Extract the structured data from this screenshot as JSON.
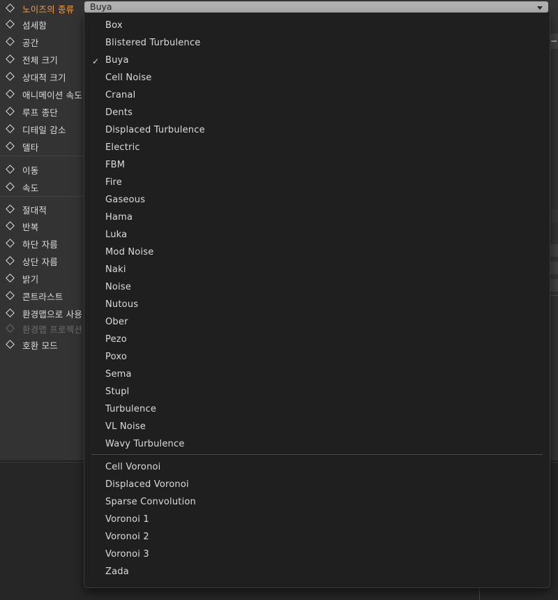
{
  "panel": {
    "properties": [
      {
        "label": "노이즈의 종류",
        "active": true
      },
      {
        "label": "섬세함"
      },
      {
        "label": "공간"
      },
      {
        "label": "전체 크기"
      },
      {
        "label": "상대적 크기"
      },
      {
        "label": "애니메이션 속도"
      },
      {
        "label": "루프 종단"
      },
      {
        "label": "디테일 감소"
      },
      {
        "label": "델타"
      },
      {
        "label": "이동"
      },
      {
        "label": "속도"
      },
      {
        "label": "절대적"
      },
      {
        "label": "반복"
      },
      {
        "label": "하단 자름"
      },
      {
        "label": "상단 자름"
      },
      {
        "label": "밝기"
      },
      {
        "label": "콘트라스트"
      },
      {
        "label": "환경맵으로 사용"
      },
      {
        "label": "환경맵 프로젝션",
        "disabled": true
      },
      {
        "label": "호환 모드"
      }
    ]
  },
  "select": {
    "value": "Buya"
  },
  "menu": {
    "check_glyph": "✓",
    "groups": [
      [
        "Box",
        "Blistered Turbulence",
        "Buya",
        "Cell Noise",
        "Cranal",
        "Dents",
        "Displaced Turbulence",
        "Electric",
        "FBM",
        "Fire",
        "Gaseous",
        "Hama",
        "Luka",
        "Mod Noise",
        "Naki",
        "Noise",
        "Nutous",
        "Ober",
        "Pezo",
        "Poxo",
        "Sema",
        "Stupl",
        "Turbulence",
        "VL Noise",
        "Wavy Turbulence"
      ],
      [
        "Cell Voronoi",
        "Displaced Voronoi",
        "Sparse Convolution",
        "Voronoi 1",
        "Voronoi 2",
        "Voronoi 3",
        "Zada"
      ]
    ],
    "selected": "Buya"
  },
  "colors": {
    "active_label": "#ff9c39",
    "menu_bg": "#1f1f1f",
    "panel_bg": "#333333"
  }
}
